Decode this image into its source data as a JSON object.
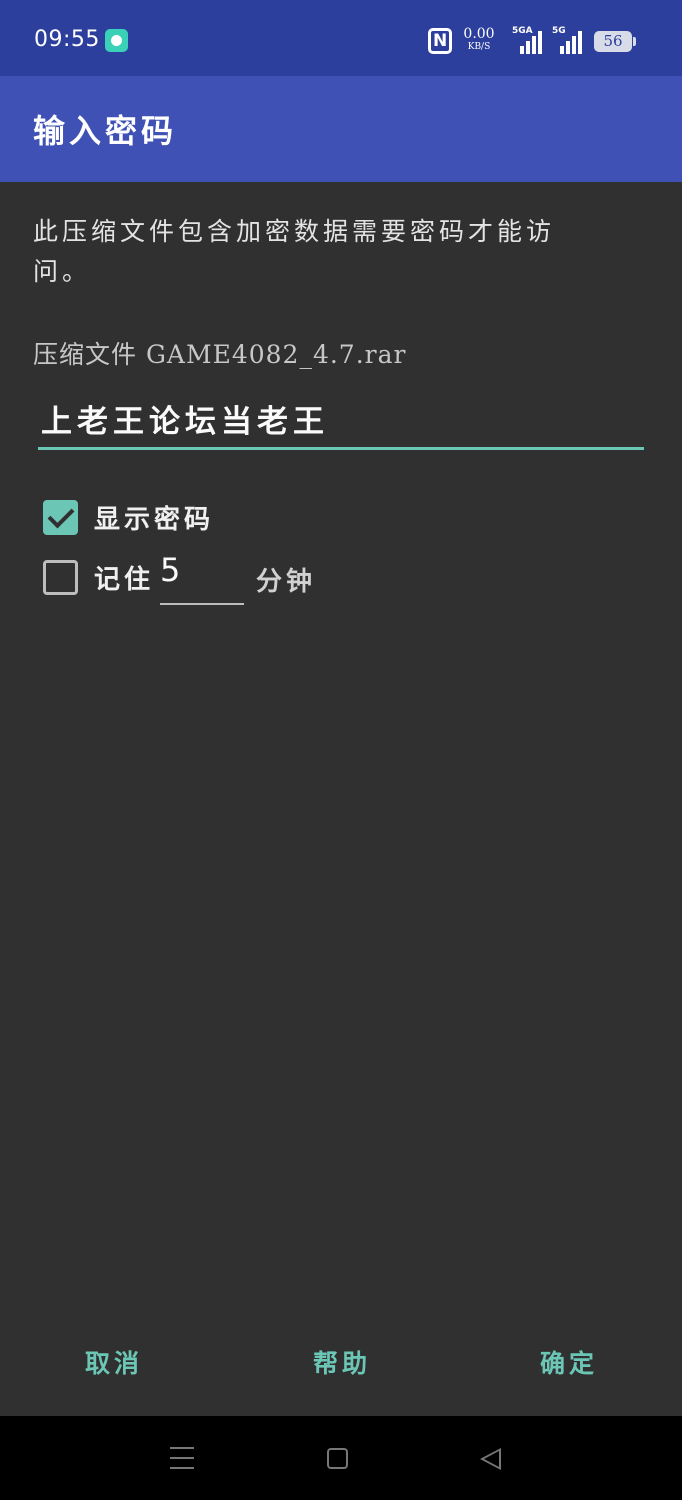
{
  "status_bar": {
    "time": "09:55",
    "app_icon": "chat-bubble-icon",
    "nfc_icon": "nfc-icon",
    "net_speed_value": "0.00",
    "net_speed_unit": "KB/S",
    "sim1_label": "5GA",
    "sim2_label": "5G",
    "battery": "56"
  },
  "app_bar": {
    "title": "输入密码"
  },
  "dialog": {
    "message": "此压缩文件包含加密数据需要密码才能访问。",
    "archive_label": "压缩文件 GAME4082_4.7.rar",
    "password_value": "上老王论坛当老王",
    "show_password_label": "显示密码",
    "show_password_checked": true,
    "remember_label": "记住",
    "remember_checked": false,
    "remember_minutes": "5",
    "minutes_unit": "分钟"
  },
  "actions": {
    "cancel": "取消",
    "help": "帮助",
    "ok": "确定"
  },
  "colors": {
    "status_bar": "#2d3f9c",
    "app_bar": "#3f51b5",
    "dialog_bg": "#303030",
    "accent": "#6cc6b5"
  },
  "nav_bar": {
    "icons": [
      "menu-icon",
      "home-icon",
      "back-icon"
    ]
  }
}
